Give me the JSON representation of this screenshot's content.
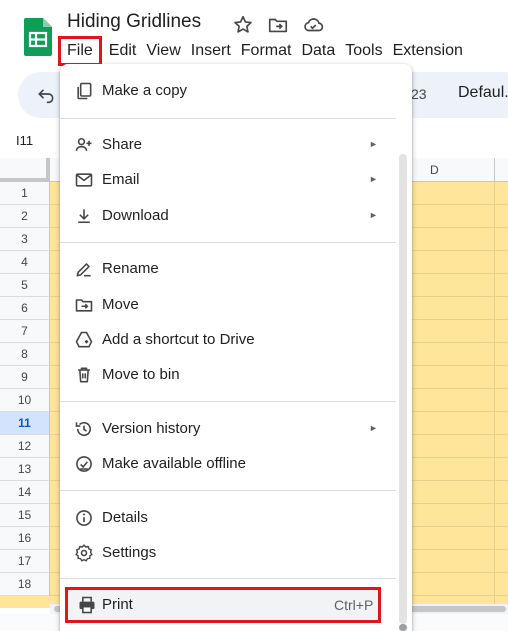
{
  "header": {
    "title": "Hiding Gridlines",
    "menus": [
      "File",
      "Edit",
      "View",
      "Insert",
      "Format",
      "Data",
      "Tools",
      "Extension"
    ]
  },
  "toolbar": {
    "number_text": "23",
    "font_text": "Defaul."
  },
  "namebox": "I11",
  "column_header": "D",
  "rows": [
    "1",
    "2",
    "3",
    "4",
    "5",
    "6",
    "7",
    "8",
    "9",
    "10",
    "11",
    "12",
    "13",
    "14",
    "15",
    "16",
    "17",
    "18"
  ],
  "active_row": "11",
  "file_menu": {
    "items": [
      {
        "label": "Make a copy",
        "icon": "copy-icon"
      },
      {
        "label": "Share",
        "icon": "share-person-icon",
        "submenu": true
      },
      {
        "label": "Email",
        "icon": "email-icon",
        "submenu": true
      },
      {
        "label": "Download",
        "icon": "download-icon",
        "submenu": true
      },
      {
        "label": "Rename",
        "icon": "rename-icon"
      },
      {
        "label": "Move",
        "icon": "move-folder-icon"
      },
      {
        "label": "Add a shortcut to Drive",
        "icon": "drive-shortcut-icon"
      },
      {
        "label": "Move to bin",
        "icon": "trash-icon"
      },
      {
        "label": "Version history",
        "icon": "history-icon",
        "submenu": true
      },
      {
        "label": "Make available offline",
        "icon": "offline-check-icon"
      },
      {
        "label": "Details",
        "icon": "info-icon"
      },
      {
        "label": "Settings",
        "icon": "gear-icon"
      },
      {
        "label": "Print",
        "icon": "print-icon",
        "shortcut": "Ctrl+P"
      }
    ],
    "submenu_arrow": "►"
  },
  "colors": {
    "highlight_border": "#e0161b",
    "cell_fill": "#ffe599",
    "sheets_green": "#0f9d58"
  }
}
